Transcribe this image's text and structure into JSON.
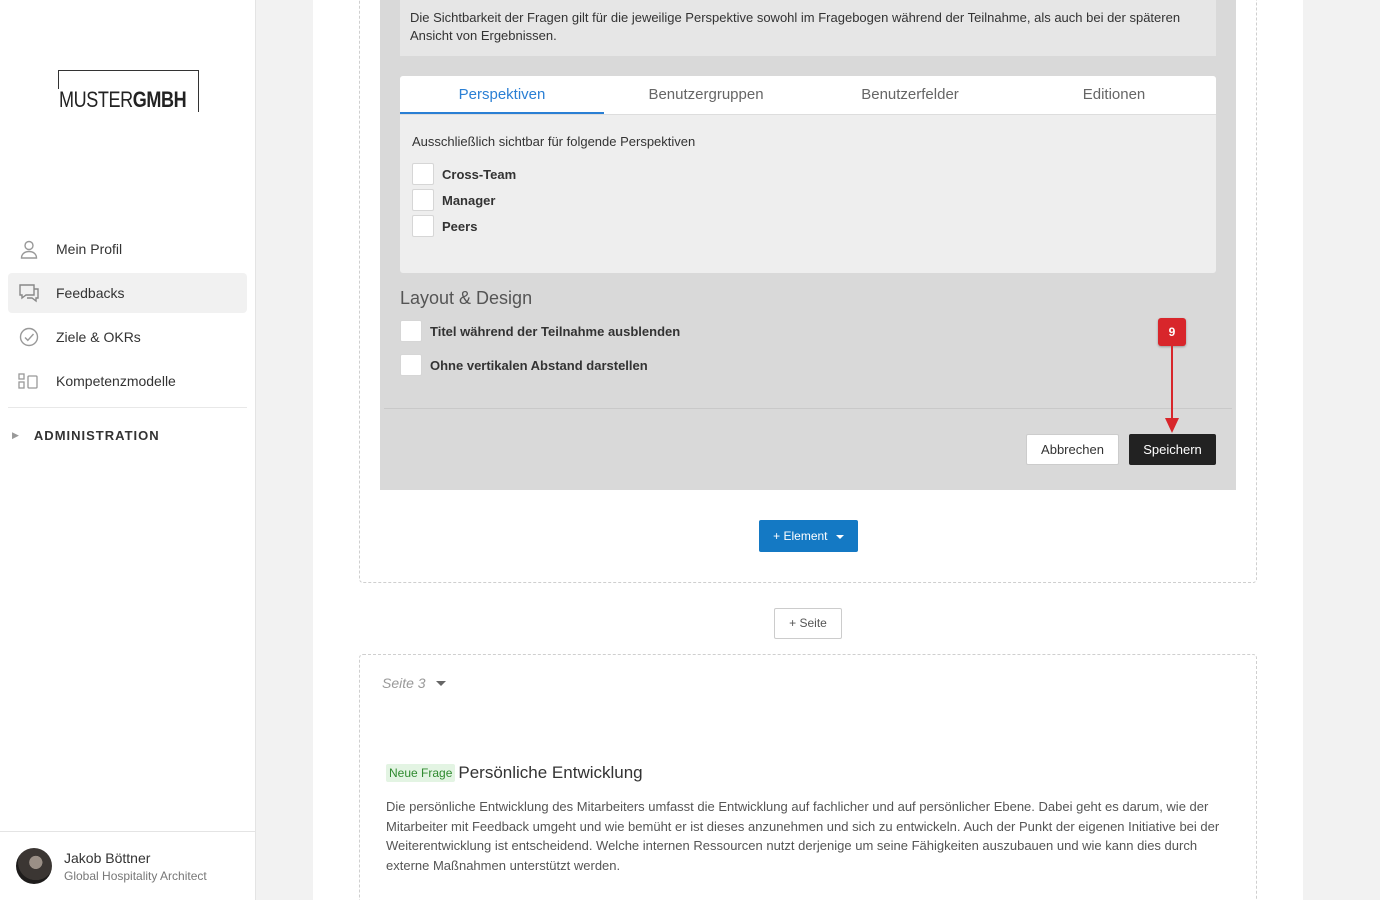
{
  "logo": {
    "part1": "MUSTER",
    "part2": "GMBH"
  },
  "sidebar": {
    "items": [
      {
        "label": "Mein Profil",
        "icon": "user-icon"
      },
      {
        "label": "Feedbacks",
        "icon": "chat-icon",
        "active": true
      },
      {
        "label": "Ziele & OKRs",
        "icon": "check-circle-icon"
      },
      {
        "label": "Kompetenzmodelle",
        "icon": "model-icon"
      }
    ],
    "admin_label": "ADMINISTRATION"
  },
  "user": {
    "name": "Jakob Böttner",
    "role": "Global Hospitality Architect"
  },
  "editor": {
    "info_text": "Die Sichtbarkeit der Fragen gilt für die jeweilige Perspektive sowohl im Fragebogen während der Teilnahme, als auch bei der späteren Ansicht von Ergebnissen.",
    "tabs": [
      "Perspektiven",
      "Benutzergruppen",
      "Benutzerfelder",
      "Editionen"
    ],
    "perspectives_label": "Ausschließlich sichtbar für folgende Perspektiven",
    "perspectives": [
      "Cross-Team",
      "Manager",
      "Peers"
    ],
    "layout_title": "Layout & Design",
    "layout_options": [
      "Titel während der Teilnahme ausblenden",
      "Ohne vertikalen Abstand darstellen"
    ],
    "cancel_label": "Abbrechen",
    "save_label": "Speichern",
    "step_badge": "9",
    "colors": {
      "accent": "#2a7fd4",
      "badge": "#d8262b",
      "primary_button": "#1479c4"
    }
  },
  "actions": {
    "add_element": "+ Element",
    "add_page": "+ Seite"
  },
  "page3": {
    "label": "Seite 3",
    "question_tag": "Neue Frage",
    "question_title": "Persönliche Entwicklung",
    "question_text": "Die persönliche Entwicklung des Mitarbeiters umfasst die Entwicklung auf fachlicher und auf persönlicher Ebene. Dabei geht es darum, wie der Mitarbeiter mit Feedback umgeht und wie bemüht er ist dieses anzunehmen und sich zu entwickeln. Auch der Punkt der eigenen Initiative bei der Weiterentwicklung ist entscheidend. Welche internen Ressourcen nutzt derjenige um seine Fähigkeiten auszubauen und wie kann dies durch externe Maßnahmen unterstützt werden."
  }
}
